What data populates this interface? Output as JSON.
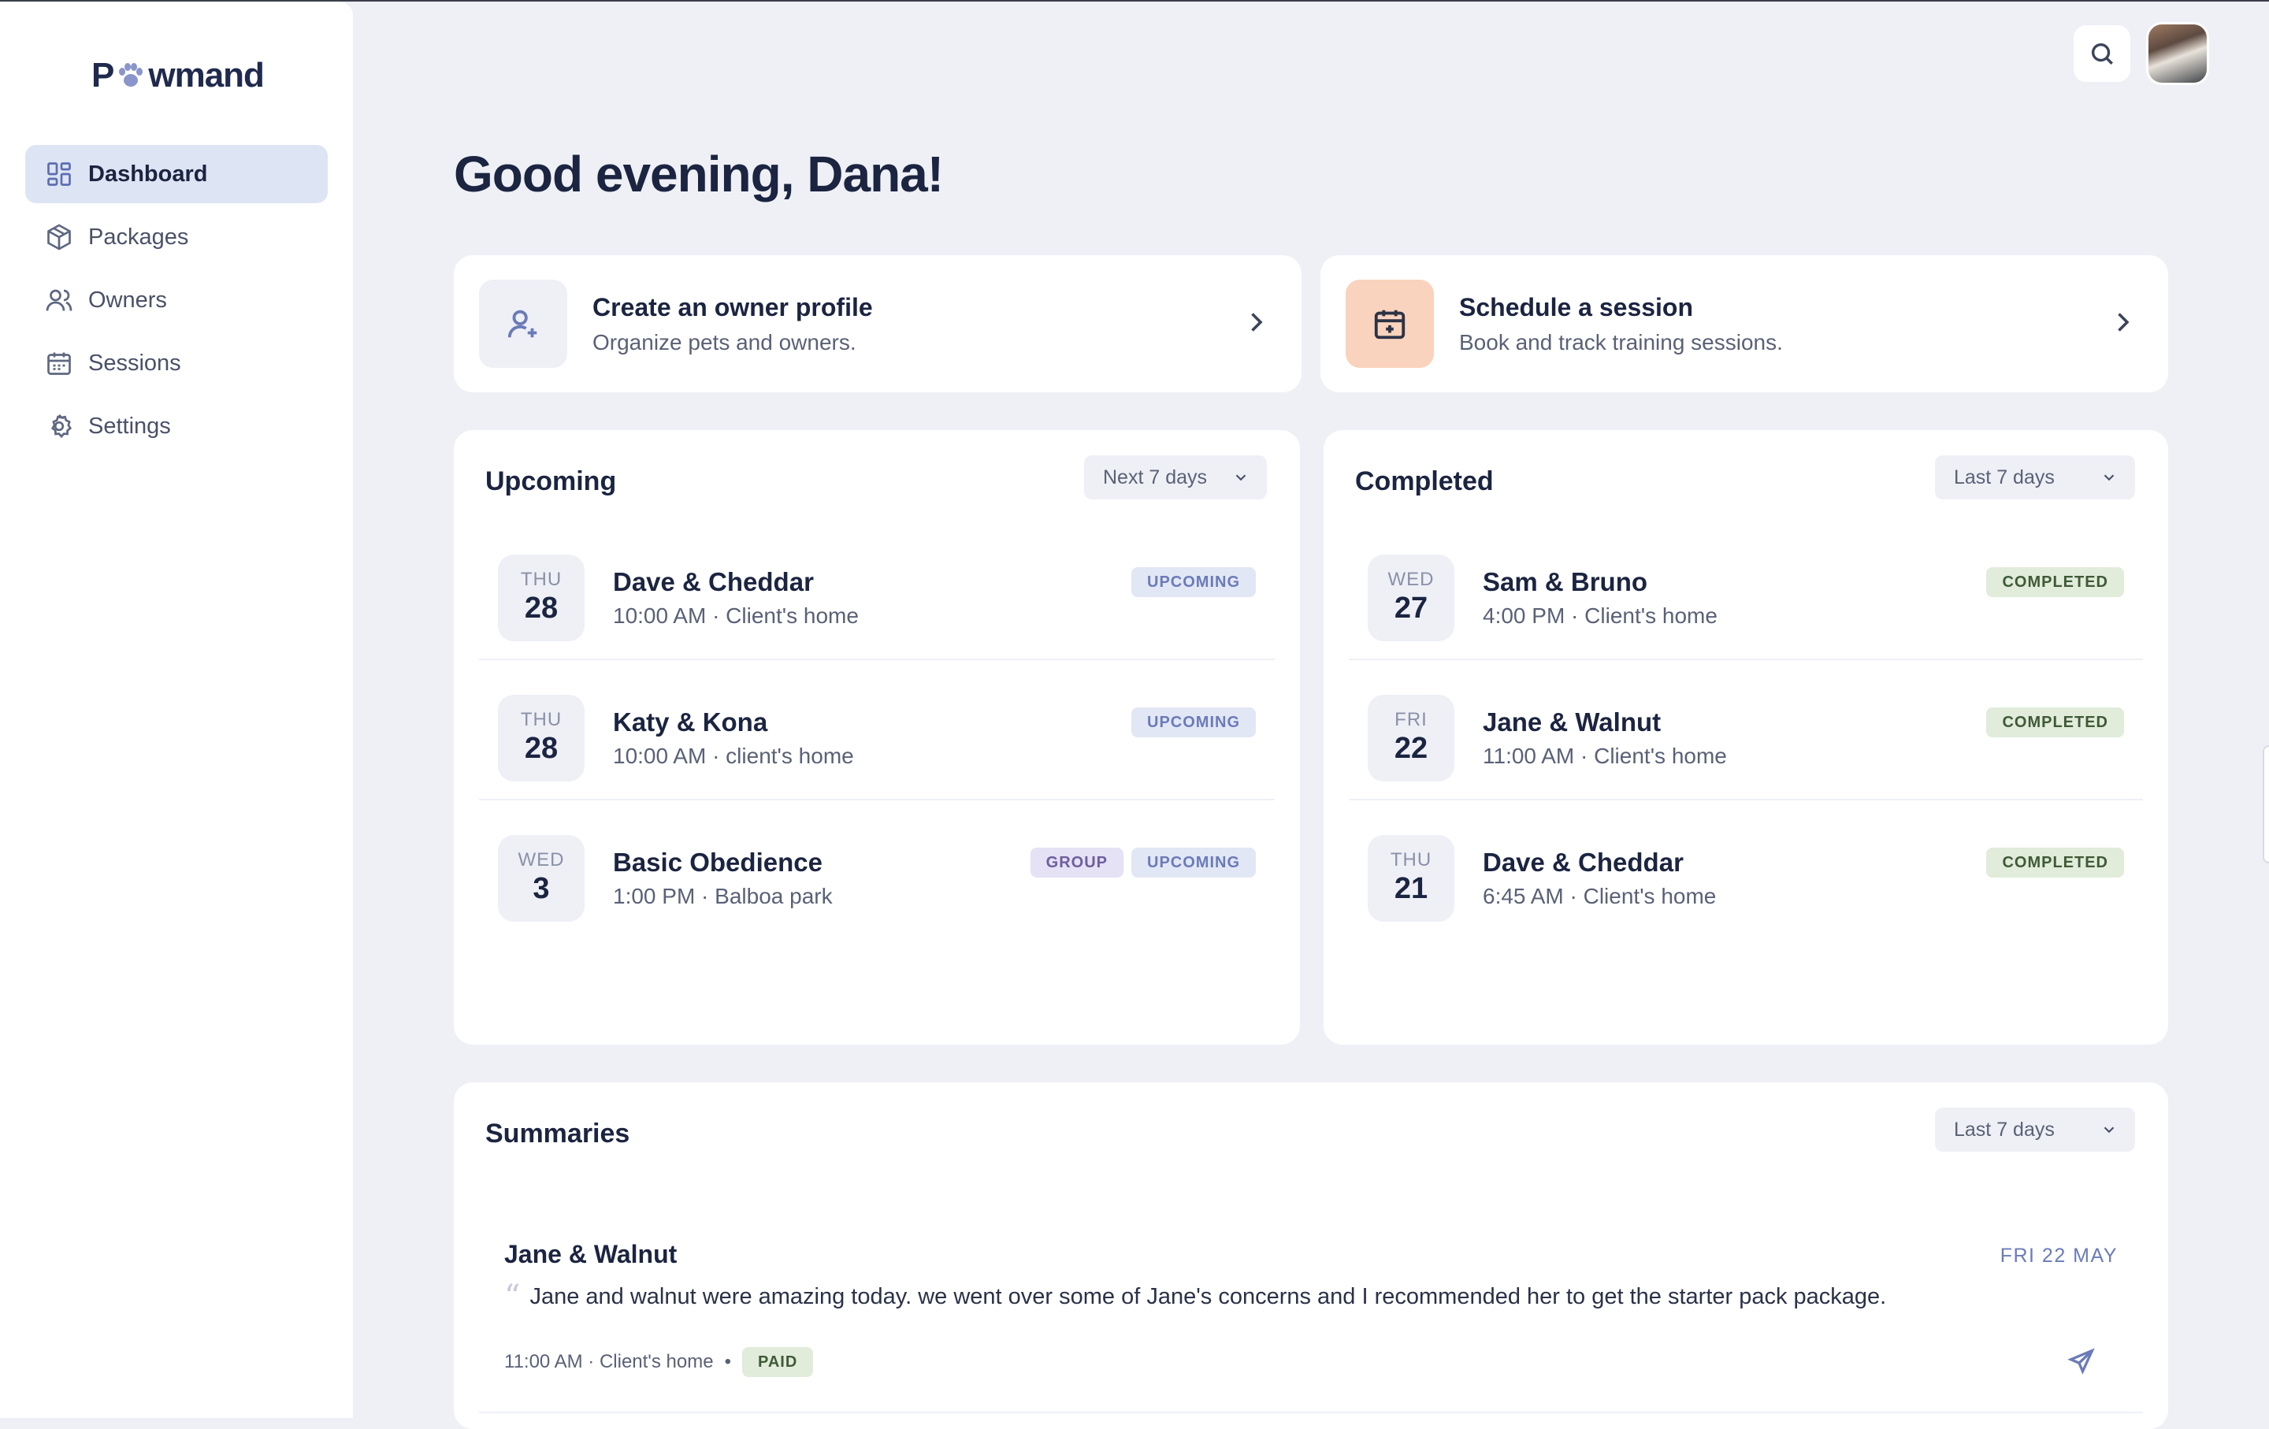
{
  "brand": {
    "logo_before": "P",
    "logo_after": "wmand"
  },
  "sidebar": {
    "items": [
      {
        "label": "Dashboard",
        "icon": "dashboard-icon",
        "active": true
      },
      {
        "label": "Packages",
        "icon": "package-icon",
        "active": false
      },
      {
        "label": "Owners",
        "icon": "users-icon",
        "active": false
      },
      {
        "label": "Sessions",
        "icon": "calendar-icon",
        "active": false
      },
      {
        "label": "Settings",
        "icon": "gear-icon",
        "active": false
      }
    ]
  },
  "header": {
    "greeting": "Good evening, Dana!"
  },
  "actions": [
    {
      "title": "Create an owner profile",
      "subtitle": "Organize pets and owners.",
      "icon": "user-plus-icon"
    },
    {
      "title": "Schedule a session",
      "subtitle": "Book and track training sessions.",
      "icon": "calendar-plus-icon"
    }
  ],
  "upcoming": {
    "title": "Upcoming",
    "filter": "Next 7 days",
    "sessions": [
      {
        "dow": "THU",
        "day": "28",
        "name": "Dave & Cheddar",
        "meta": "10:00 AM · Client's home",
        "badges": [
          "UPCOMING"
        ]
      },
      {
        "dow": "THU",
        "day": "28",
        "name": "Katy & Kona",
        "meta": "10:00 AM · client's home",
        "badges": [
          "UPCOMING"
        ]
      },
      {
        "dow": "WED",
        "day": "3",
        "name": "Basic Obedience",
        "meta": "1:00 PM · Balboa park",
        "badges": [
          "GROUP",
          "UPCOMING"
        ]
      }
    ]
  },
  "completed": {
    "title": "Completed",
    "filter": "Last 7 days",
    "sessions": [
      {
        "dow": "WED",
        "day": "27",
        "name": "Sam & Bruno",
        "meta": "4:00 PM · Client's home",
        "badges": [
          "COMPLETED"
        ]
      },
      {
        "dow": "FRI",
        "day": "22",
        "name": "Jane & Walnut",
        "meta": "11:00 AM · Client's home",
        "badges": [
          "COMPLETED"
        ]
      },
      {
        "dow": "THU",
        "day": "21",
        "name": "Dave & Cheddar",
        "meta": "6:45 AM · Client's home",
        "badges": [
          "COMPLETED"
        ]
      }
    ]
  },
  "summaries": {
    "title": "Summaries",
    "filter": "Last 7 days",
    "items": [
      {
        "name": "Jane & Walnut",
        "date": "FRI 22 MAY",
        "quote": "Jane and walnut were amazing today. we went over some of Jane's concerns and I recommended her to get the starter pack package.",
        "meta": "11:00 AM · Client's home",
        "separator": "•",
        "badge": "PAID"
      }
    ]
  },
  "colors": {
    "accent": "#5c6db1",
    "background": "#eef0f6",
    "schedule_icon_bg": "#f9d3bd",
    "owner_icon_bg": "#eef0f6"
  }
}
